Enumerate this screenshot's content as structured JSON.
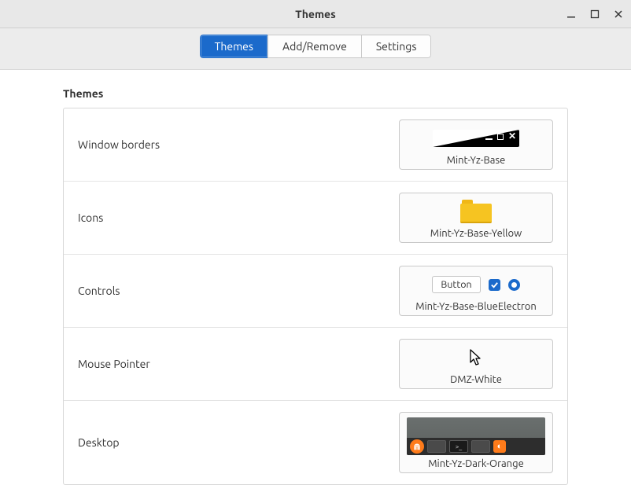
{
  "window": {
    "title": "Themes"
  },
  "tabs": {
    "themes": "Themes",
    "add_remove": "Add/Remove",
    "settings": "Settings",
    "active": "themes"
  },
  "section": {
    "heading": "Themes"
  },
  "rows": {
    "window_borders": {
      "label": "Window borders",
      "value": "Mint-Yz-Base"
    },
    "icons": {
      "label": "Icons",
      "value": "Mint-Yz-Base-Yellow"
    },
    "controls": {
      "label": "Controls",
      "value": "Mint-Yz-Base-BlueElectron",
      "button_text": "Button"
    },
    "mouse_pointer": {
      "label": "Mouse Pointer",
      "value": "DMZ-White"
    },
    "desktop": {
      "label": "Desktop",
      "value": "Mint-Yz-Dark-Orange"
    }
  },
  "colors": {
    "accent_blue": "#1b6acb",
    "folder_yellow": "#f6c421",
    "orange": "#ff7b1a"
  }
}
